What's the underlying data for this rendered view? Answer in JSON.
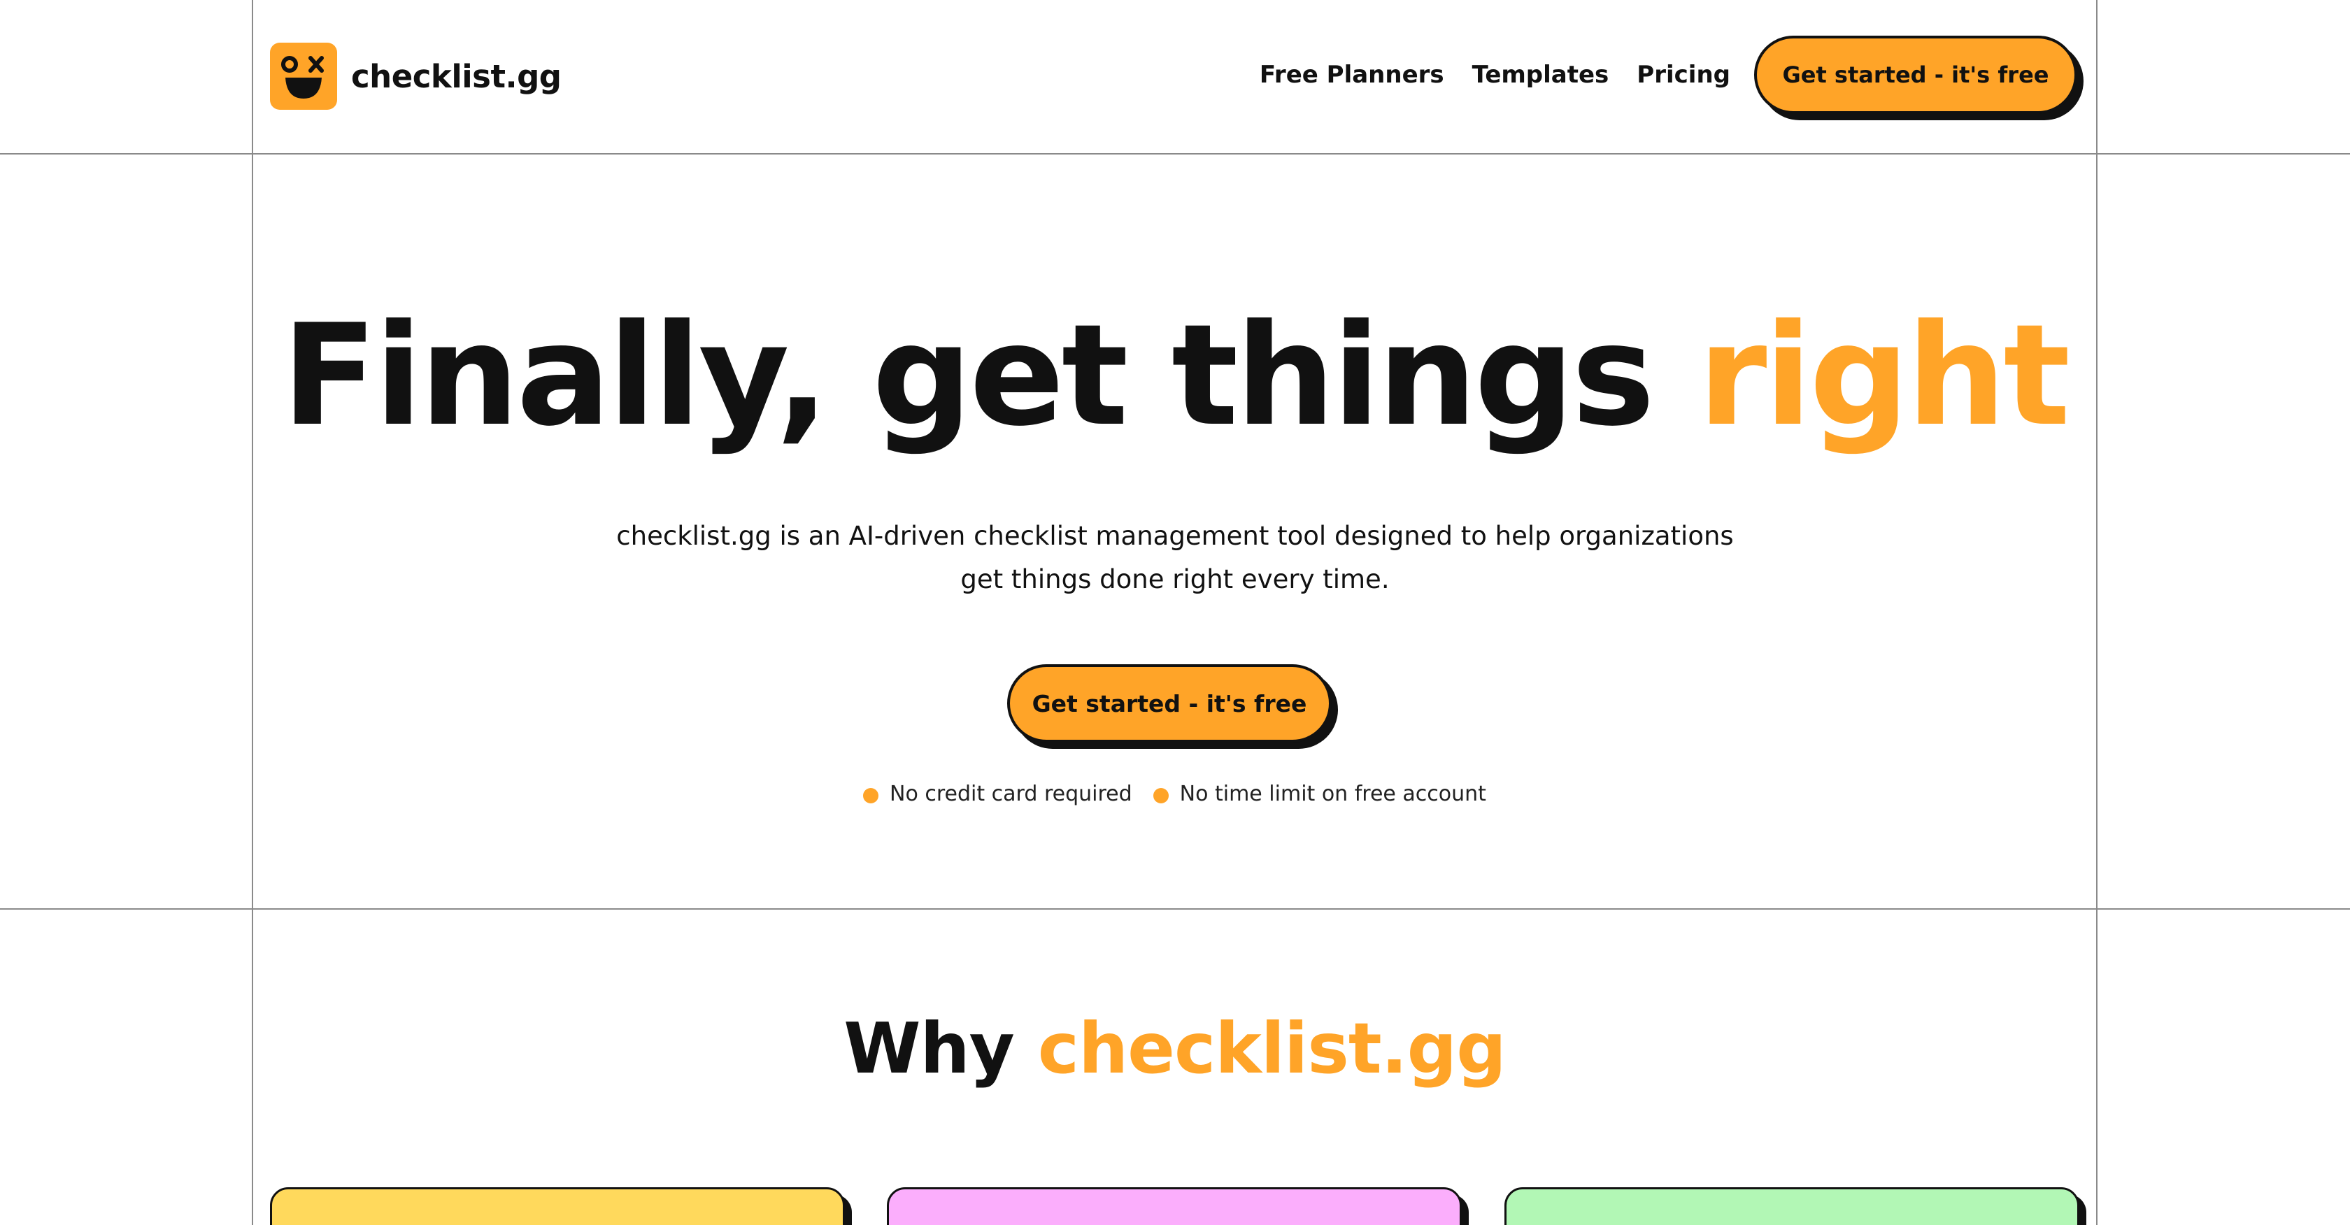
{
  "brand": {
    "name": "checklist.gg",
    "accent_color": "#ffa428",
    "logo_icon": "smiley-wink-icon"
  },
  "nav": {
    "items": [
      {
        "label": "Free Planners"
      },
      {
        "label": "Templates"
      },
      {
        "label": "Pricing"
      }
    ],
    "cta_label": "Get started - it's free"
  },
  "hero": {
    "title_main": "Finally, get things ",
    "title_accent": "right",
    "subtitle_line1": "checklist.gg is an AI-driven checklist management tool designed to help organizations",
    "subtitle_line2": "get things done right every time.",
    "cta_label": "Get started - it's free",
    "perks": [
      "No credit card required",
      "No time limit on free account"
    ]
  },
  "why": {
    "title_main": "Why ",
    "title_accent": "checklist.gg",
    "card_colors": [
      "#ffd95c",
      "#fbaefc",
      "#b2f7b5"
    ]
  }
}
